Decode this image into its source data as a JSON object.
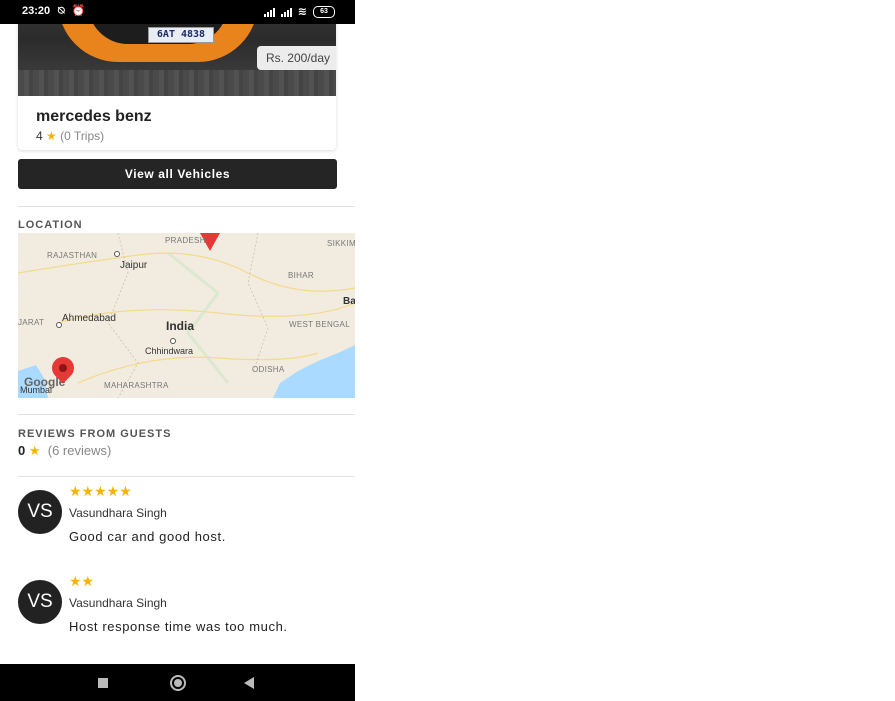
{
  "status_bar": {
    "time": "23:20",
    "left_icons": "⍉ ⏰",
    "battery": "63"
  },
  "vehicle": {
    "plate": "6AT 4838",
    "price": "Rs. 200/day",
    "name": "mercedes benz",
    "rating": "4",
    "trips": "(0 Trips)"
  },
  "view_all_label": "View all Vehicles",
  "location": {
    "title": "LOCATION",
    "map_labels": {
      "pradesh": "PRADESH",
      "sikkim": "SIKKIM",
      "rajasthan": "RAJASTHAN",
      "jaipur": "Jaipur",
      "bihar": "BIHAR",
      "ba": "Ba",
      "gujarat": "JARAT",
      "ahmedabad": "Ahmedabad",
      "india": "India",
      "west_bengal": "WEST BENGAL",
      "chhindwara": "Chhindwara",
      "odisha": "ODISHA",
      "maharashtra": "MAHARASHTRA",
      "mumbai": "Mumbai",
      "google": "Google"
    }
  },
  "reviews": {
    "title": "REVIEWS FROM GUESTS",
    "average": "0",
    "count": "(6 reviews)",
    "items": [
      {
        "initials": "VS",
        "stars": "★★★★★",
        "rating": 5,
        "name": "Vasundhara Singh",
        "text": "Good car and good host."
      },
      {
        "initials": "VS",
        "stars": "★★",
        "rating": 2,
        "name": "Vasundhara Singh",
        "text": "Host response time was too much."
      }
    ]
  },
  "colors": {
    "star": "#f5b400",
    "button_bg": "#252525",
    "pin": "#e53935"
  }
}
